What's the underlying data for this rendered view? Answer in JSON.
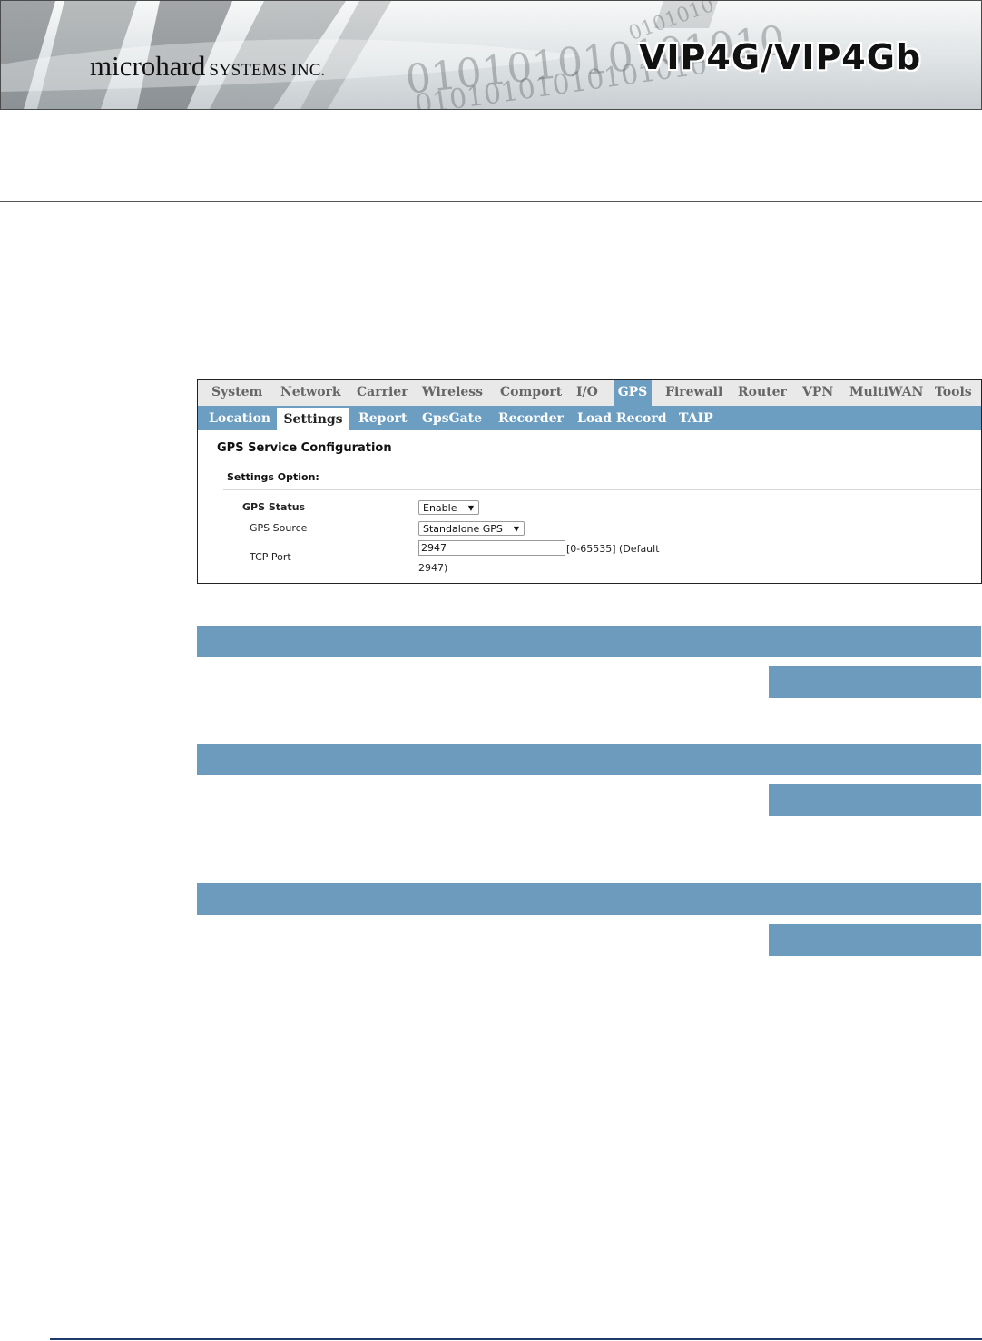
{
  "header": {
    "brand_name": "microhard",
    "brand_suffix": "SYSTEMS INC.",
    "product": "VIP4G/VIP4Gb",
    "binary_text_1": "010101010101010",
    "binary_text_2": "01010101010101010",
    "binary_text_3": "0101010"
  },
  "screenshot": {
    "top_tabs": [
      "System",
      "Network",
      "Carrier",
      "Wireless",
      "Comport",
      "I/O",
      "GPS",
      "Firewall",
      "Router",
      "VPN",
      "MultiWAN",
      "Tools"
    ],
    "active_top_tab": "GPS",
    "sub_tabs": [
      "Location",
      "Settings",
      "Report",
      "GpsGate",
      "Recorder",
      "Load Record",
      "TAIP"
    ],
    "active_sub_tab": "Settings",
    "section_title": "GPS Service Configuration",
    "settings_option_title": "Settings Option:",
    "gps_status": {
      "label": "GPS Status",
      "value": "Enable"
    },
    "gps_source": {
      "label": "GPS Source",
      "value": "Standalone GPS"
    },
    "tcp_port": {
      "label": "TCP Port",
      "value": "2947",
      "hint_line1": "[0-65535] (Default",
      "hint_line2": "2947)"
    }
  },
  "colors": {
    "accent_blue": "#6c9ec2",
    "bar_blue": "#6c9bbd",
    "tab_grey": "#e9e9e9"
  },
  "icons": {
    "dropdown": "triangle-down-icon"
  }
}
